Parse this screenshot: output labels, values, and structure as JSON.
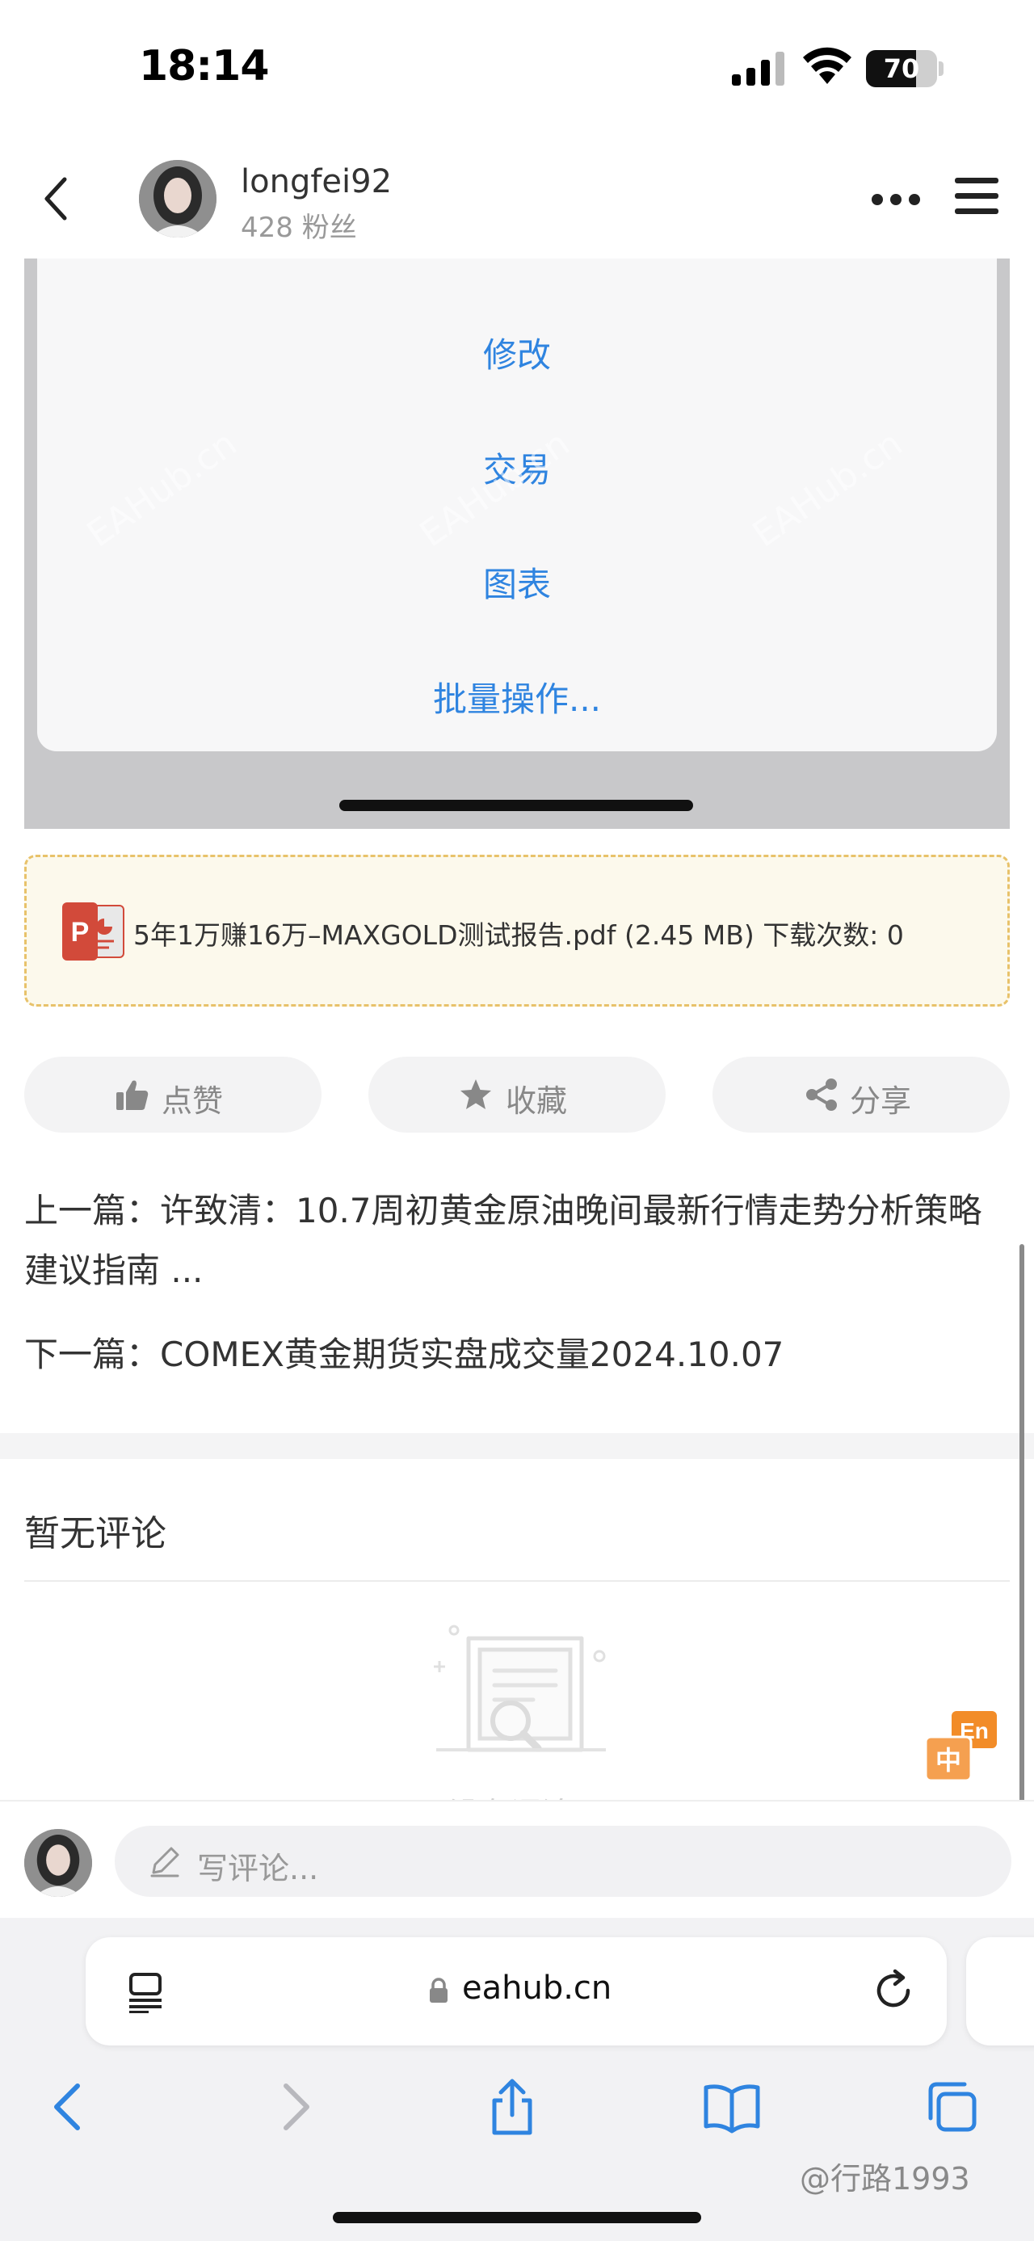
{
  "status_bar": {
    "time": "18:14",
    "battery": "70",
    "battery_level": 0.7
  },
  "header": {
    "username": "longfei92",
    "followers": "428 粉丝"
  },
  "embedded_screenshot": {
    "menu_items": [
      "修改",
      "交易",
      "图表",
      "批量操作..."
    ],
    "watermark": "EAHub.cn"
  },
  "attachment": {
    "icon": "powerpoint-icon",
    "text": "5年1万赚16万–MAXGOLD测试报告.pdf (2.45 MB) 下载次数: 0"
  },
  "actions": {
    "like": "点赞",
    "favorite": "收藏",
    "share": "分享"
  },
  "navigation": {
    "prev": "上一篇：许致清：10.7周初黄金原油晚间最新行情走势分析策略建议指南 ...",
    "next": "下一篇：COMEX黄金期货实盘成交量2024.10.07"
  },
  "comments": {
    "title": "暂无评论",
    "empty_text": "没有评论",
    "placeholder": "写评论..."
  },
  "browser": {
    "domain": "eahub.cn"
  },
  "credit": "@行路1993",
  "colors": {
    "accent": "#2f84e0",
    "attachment_border": "#e8c26a",
    "translate_orange": "#f28c28"
  }
}
